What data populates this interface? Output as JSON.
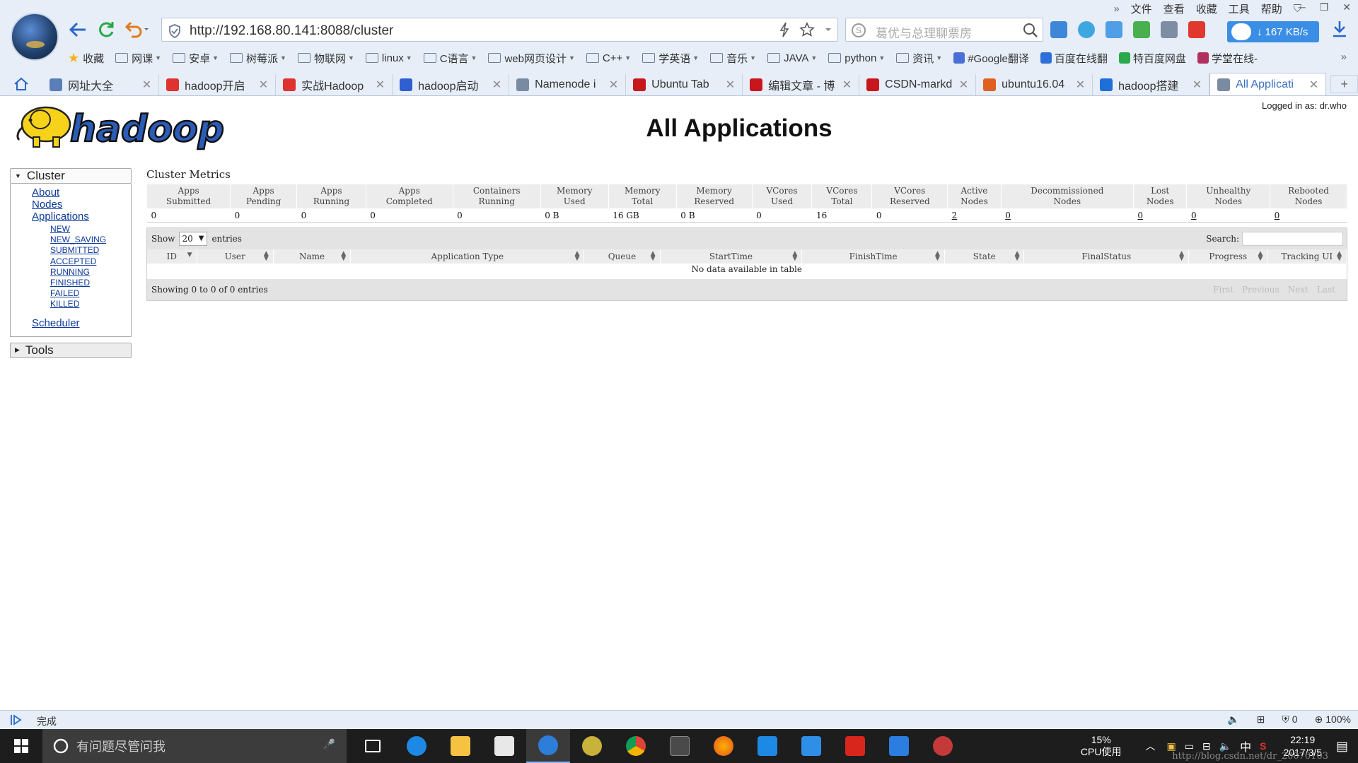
{
  "browser": {
    "url": "http://192.168.80.141:8088/cluster",
    "search_placeholder": "葛优与总理聊票房",
    "menu": [
      "文件",
      "查看",
      "收藏",
      "工具",
      "帮助"
    ],
    "speed": "167 KB/s",
    "bookmarks": [
      {
        "label": "收藏",
        "type": "star"
      },
      {
        "label": "网课",
        "type": "folder"
      },
      {
        "label": "安卓",
        "type": "folder"
      },
      {
        "label": "树莓派",
        "type": "folder"
      },
      {
        "label": "物联网",
        "type": "folder"
      },
      {
        "label": "linux",
        "type": "folder"
      },
      {
        "label": "C语言",
        "type": "folder"
      },
      {
        "label": "web网页设计",
        "type": "folder"
      },
      {
        "label": "C++",
        "type": "folder"
      },
      {
        "label": "学英语",
        "type": "folder"
      },
      {
        "label": "音乐",
        "type": "folder"
      },
      {
        "label": "JAVA",
        "type": "folder"
      },
      {
        "label": "python",
        "type": "folder"
      },
      {
        "label": "资讯",
        "type": "folder"
      },
      {
        "label": "#Google翻译",
        "type": "link",
        "color": "#4a6fd6"
      },
      {
        "label": "百度在线翻",
        "type": "link",
        "color": "#2f6fd8"
      },
      {
        "label": "特百度网盘",
        "type": "link",
        "color": "#2aa84a"
      },
      {
        "label": "学堂在线-",
        "type": "link",
        "color": "#b03060"
      }
    ],
    "tabs": [
      {
        "title": "网址大全",
        "color": "#5a7fb8"
      },
      {
        "title": "hadoop开启",
        "color": "#e0322e"
      },
      {
        "title": "实战Hadoop",
        "color": "#e0322e"
      },
      {
        "title": "hadoop启动",
        "color": "#2f5fd0"
      },
      {
        "title": "Namenode i",
        "color": "#7a8aa0"
      },
      {
        "title": "Ubuntu Tab",
        "color": "#c8161d"
      },
      {
        "title": "编辑文章 - 博",
        "color": "#c8161d"
      },
      {
        "title": "CSDN-markd",
        "color": "#c8161d"
      },
      {
        "title": "ubuntu16.04",
        "color": "#e06020"
      },
      {
        "title": "hadoop搭建",
        "color": "#1e6fd8"
      },
      {
        "title": "All Applicati",
        "color": "#7a8aa0",
        "active": true
      }
    ]
  },
  "page": {
    "logo_text": "hadoop",
    "logged_in": "Logged in as: dr.who",
    "title": "All Applications",
    "nav": {
      "cluster_label": "Cluster",
      "links": [
        "About",
        "Nodes",
        "Applications"
      ],
      "app_states": [
        "NEW",
        "NEW_SAVING",
        "SUBMITTED",
        "ACCEPTED",
        "RUNNING",
        "FINISHED",
        "FAILED",
        "KILLED"
      ],
      "scheduler": "Scheduler",
      "tools_label": "Tools"
    },
    "metrics": {
      "title": "Cluster Metrics",
      "headers": [
        [
          "Apps",
          "Submitted"
        ],
        [
          "Apps",
          "Pending"
        ],
        [
          "Apps",
          "Running"
        ],
        [
          "Apps",
          "Completed"
        ],
        [
          "Containers",
          "Running"
        ],
        [
          "Memory",
          "Used"
        ],
        [
          "Memory",
          "Total"
        ],
        [
          "Memory",
          "Reserved"
        ],
        [
          "VCores",
          "Used"
        ],
        [
          "VCores",
          "Total"
        ],
        [
          "VCores",
          "Reserved"
        ],
        [
          "Active",
          "Nodes"
        ],
        [
          "Decommissioned",
          "Nodes"
        ],
        [
          "Lost",
          "Nodes"
        ],
        [
          "Unhealthy",
          "Nodes"
        ],
        [
          "Rebooted",
          "Nodes"
        ]
      ],
      "values": [
        "0",
        "0",
        "0",
        "0",
        "0",
        "0 B",
        "16 GB",
        "0 B",
        "0",
        "16",
        "0",
        "2",
        "0",
        "0",
        "0",
        "0"
      ],
      "linked": [
        false,
        false,
        false,
        false,
        false,
        false,
        false,
        false,
        false,
        false,
        false,
        true,
        true,
        true,
        true,
        true
      ]
    },
    "apps": {
      "show": "Show",
      "page_len": "20",
      "entries": "entries",
      "search_label": "Search:",
      "columns": [
        "ID",
        "User",
        "Name",
        "Application Type",
        "Queue",
        "StartTime",
        "FinishTime",
        "State",
        "FinalStatus",
        "Progress",
        "Tracking UI"
      ],
      "empty": "No data available in table",
      "info": "Showing 0 to 0 of 0 entries",
      "pager": [
        "First",
        "Previous",
        "Next",
        "Last"
      ]
    }
  },
  "status": {
    "text": "完成",
    "zoom": "100%",
    "count": "0"
  },
  "taskbar": {
    "search_placeholder": "有问题尽管问我",
    "cpu_percent": "15%",
    "cpu_label": "CPU使用",
    "ime": "中",
    "time": "22:19",
    "date": "2017/3/5",
    "watermark": "http://blog.csdn.net/dr_20070103"
  }
}
